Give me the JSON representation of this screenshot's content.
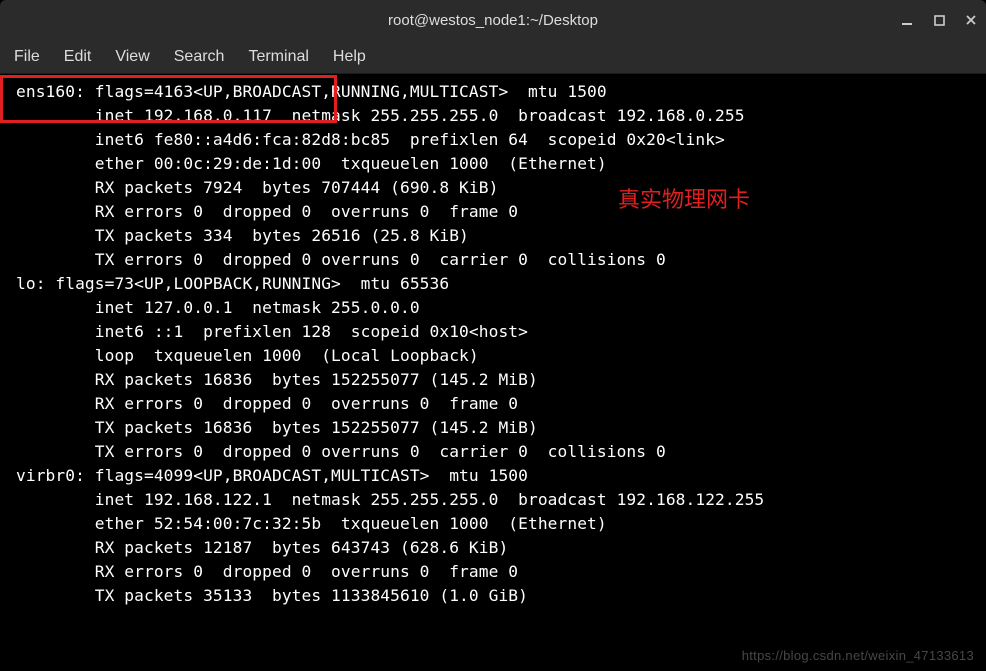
{
  "window": {
    "title": "root@westos_node1:~/Desktop"
  },
  "menu": {
    "file": "File",
    "edit": "Edit",
    "view": "View",
    "search": "Search",
    "terminal": "Terminal",
    "help": "Help"
  },
  "terminal_lines": [
    "ens160: flags=4163<UP,BROADCAST,RUNNING,MULTICAST>  mtu 1500",
    "        inet 192.168.0.117  netmask 255.255.255.0  broadcast 192.168.0.255",
    "        inet6 fe80::a4d6:fca:82d8:bc85  prefixlen 64  scopeid 0x20<link>",
    "        ether 00:0c:29:de:1d:00  txqueuelen 1000  (Ethernet)",
    "        RX packets 7924  bytes 707444 (690.8 KiB)",
    "        RX errors 0  dropped 0  overruns 0  frame 0",
    "        TX packets 334  bytes 26516 (25.8 KiB)",
    "        TX errors 0  dropped 0 overruns 0  carrier 0  collisions 0",
    "",
    "lo: flags=73<UP,LOOPBACK,RUNNING>  mtu 65536",
    "        inet 127.0.0.1  netmask 255.0.0.0",
    "        inet6 ::1  prefixlen 128  scopeid 0x10<host>",
    "        loop  txqueuelen 1000  (Local Loopback)",
    "        RX packets 16836  bytes 152255077 (145.2 MiB)",
    "        RX errors 0  dropped 0  overruns 0  frame 0",
    "        TX packets 16836  bytes 152255077 (145.2 MiB)",
    "        TX errors 0  dropped 0 overruns 0  carrier 0  collisions 0",
    "",
    "virbr0: flags=4099<UP,BROADCAST,MULTICAST>  mtu 1500",
    "        inet 192.168.122.1  netmask 255.255.255.0  broadcast 192.168.122.255",
    "        ether 52:54:00:7c:32:5b  txqueuelen 1000  (Ethernet)",
    "        RX packets 12187  bytes 643743 (628.6 KiB)",
    "        RX errors 0  dropped 0  overruns 0  frame 0",
    "        TX packets 35133  bytes 1133845610 (1.0 GiB)"
  ],
  "annotation": {
    "text": "真实物理网卡"
  },
  "watermark": "https://blog.csdn.net/weixin_47133613"
}
